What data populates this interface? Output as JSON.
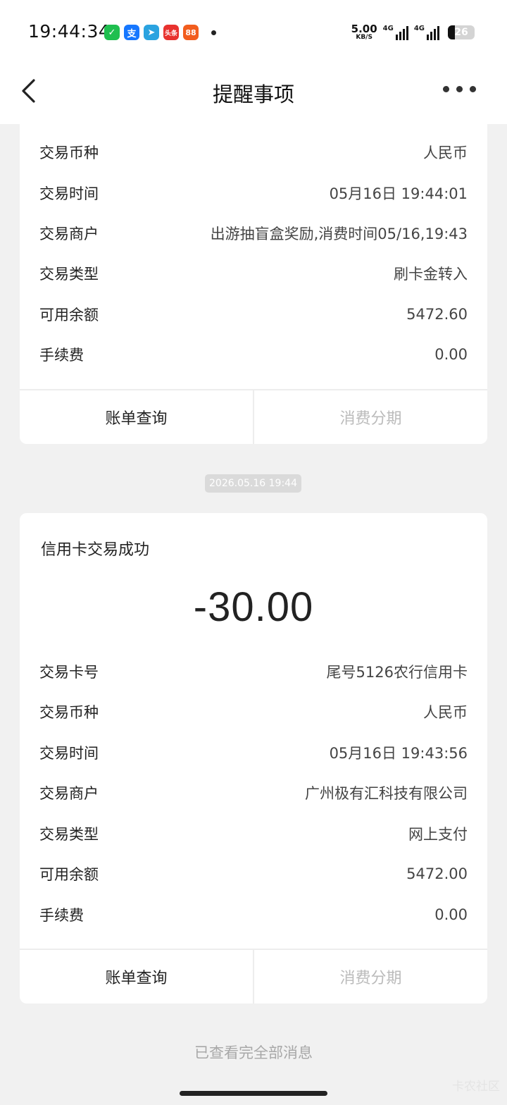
{
  "status_bar": {
    "time": "19:44:34",
    "net_speed": "5.00",
    "net_unit": "KB/S",
    "signal1_label": "4G",
    "signal2_label": "4G",
    "battery": "26",
    "apps": [
      {
        "name": "wechat-icon",
        "glyph": "✓",
        "color": "#1fbf4f"
      },
      {
        "name": "alipay-icon",
        "glyph": "支",
        "color": "#1677ff"
      },
      {
        "name": "telegram-icon",
        "glyph": "➤",
        "color": "#2aa3e0"
      },
      {
        "name": "toutiao-icon",
        "glyph": "头条",
        "color": "#e8322e"
      },
      {
        "name": "app-orange-icon",
        "glyph": "88",
        "color": "#f25d1e"
      }
    ]
  },
  "header": {
    "title": "提醒事项"
  },
  "card1": {
    "rows": [
      {
        "label": "交易币种",
        "value": "人民币"
      },
      {
        "label": "交易时间",
        "value": "05月16日 19:44:01"
      },
      {
        "label": "交易商户",
        "value": "出游抽盲盒奖励,消费时间05/16,19:43"
      },
      {
        "label": "交易类型",
        "value": "刷卡金转入"
      },
      {
        "label": "可用余额",
        "value": "5472.60"
      },
      {
        "label": "手续费",
        "value": "0.00"
      }
    ],
    "actions": {
      "bill": "账单查询",
      "installment": "消费分期"
    }
  },
  "timestamp": "2026.05.16 19:44",
  "card2": {
    "title": "信用卡交易成功",
    "amount": "-30.00",
    "rows": [
      {
        "label": "交易卡号",
        "value": "尾号5126农行信用卡"
      },
      {
        "label": "交易币种",
        "value": "人民币"
      },
      {
        "label": "交易时间",
        "value": "05月16日 19:43:56"
      },
      {
        "label": "交易商户",
        "value": "广州极有汇科技有限公司"
      },
      {
        "label": "交易类型",
        "value": "网上支付"
      },
      {
        "label": "可用余额",
        "value": "5472.00"
      },
      {
        "label": "手续费",
        "value": "0.00"
      }
    ],
    "actions": {
      "bill": "账单查询",
      "installment": "消费分期"
    }
  },
  "footer": "已查看完全部消息",
  "watermark": "卡农社区"
}
